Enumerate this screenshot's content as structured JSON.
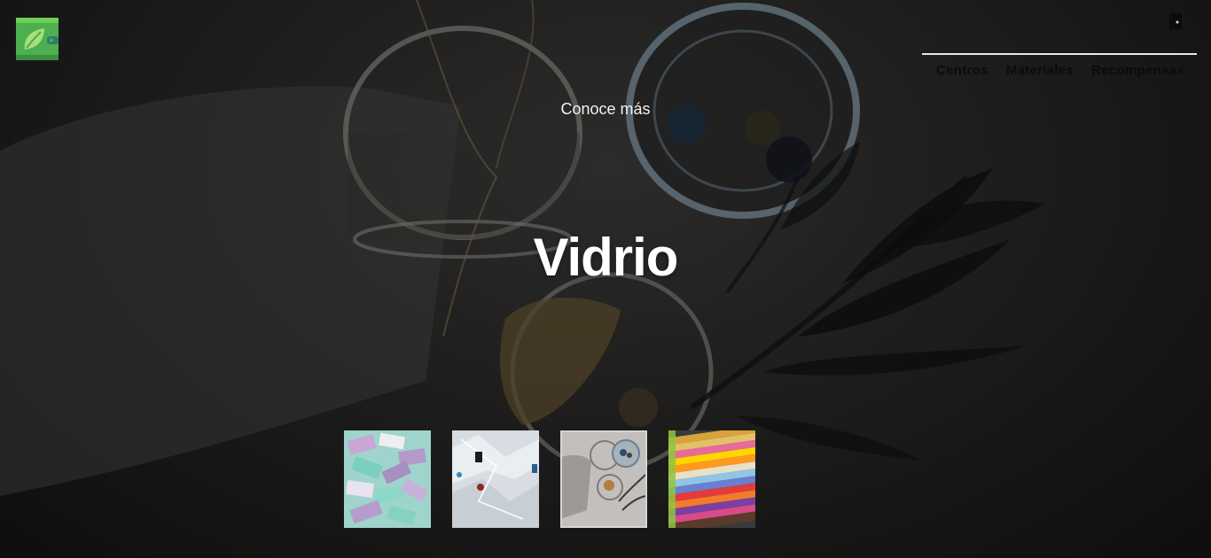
{
  "header": {
    "logo_icon": "leaf-wallet-icon",
    "user_icon": "door-icon",
    "nav": [
      {
        "label": "Centros"
      },
      {
        "label": "Materiales"
      },
      {
        "label": "Recompensas"
      }
    ]
  },
  "hero": {
    "subtitle": "Conoce más",
    "title": "Vidrio"
  },
  "materials": [
    {
      "icon": "paper-icon",
      "active": false
    },
    {
      "icon": "plastic-icon",
      "active": false
    },
    {
      "icon": "glass-icon",
      "active": true
    },
    {
      "icon": "textile-icon",
      "active": false
    }
  ],
  "colors": {
    "logo_green": "#4caf50",
    "nav_text": "#0b0b0b",
    "hero_text": "#ffffff"
  }
}
